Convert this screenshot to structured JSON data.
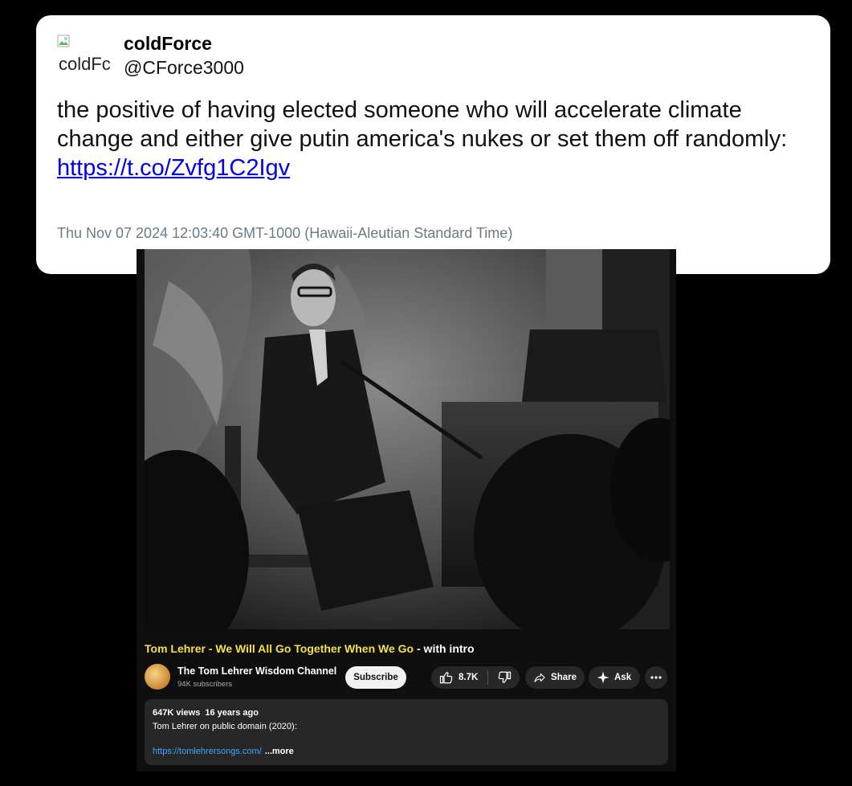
{
  "tweet": {
    "avatar_alt": "coldFc",
    "display_name": "coldForce",
    "handle": "@CForce3000",
    "text": "the positive of having elected someone who will accelerate climate change and either give putin america's nukes or set them off randomly:",
    "link": "https://t.co/Zvfg1C2Igv",
    "timestamp": "Thu Nov 07 2024 12:03:40 GMT-1000 (Hawaii-Aleutian Standard Time)"
  },
  "youtube": {
    "title_highlight": "Tom Lehrer - We Will All Go Together When We Go",
    "title_rest": " - with intro",
    "channel_name": "The Tom Lehrer Wisdom Channel",
    "subscribers": "94K subscribers",
    "subscribe_label": "Subscribe",
    "likes": "8.7K",
    "share_label": "Share",
    "ask_label": "Ask",
    "views": "647K views",
    "age": "16 years ago",
    "description_line": "Tom Lehrer on public domain (2020):",
    "description_link": "https://tomlehrersongs.com/",
    "more_label": "...more",
    "icons": [
      "thumbs-up-icon",
      "thumbs-down-icon",
      "share-icon",
      "sparkle-icon",
      "more-icon"
    ],
    "colors": {
      "title_highlight": "#f5e04a",
      "link": "#3ea6ff",
      "background": "#0f0f0f",
      "pill": "#272727"
    }
  }
}
